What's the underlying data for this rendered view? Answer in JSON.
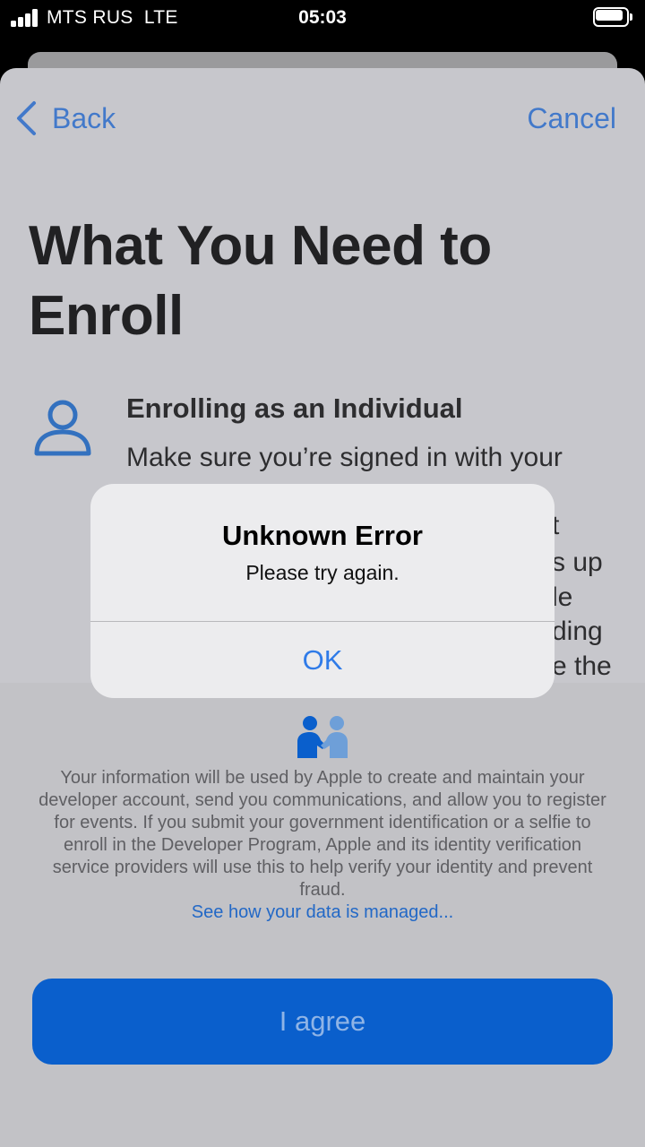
{
  "status_bar": {
    "carrier": "MTS RUS  LTE",
    "time": "05:03"
  },
  "nav": {
    "back_label": "Back",
    "cancel_label": "Cancel"
  },
  "page": {
    "title": "What You Need to Enroll",
    "section_title": "Enrolling as an Individual",
    "section_text_visible": "Make sure you’re signed in with your",
    "fragments": [
      "t",
      "s up",
      "le",
      "ding",
      "e the"
    ]
  },
  "privacy": {
    "text": "Your information will be used by Apple to create and maintain your developer account, send you communications, and allow you to register for events. If you submit your government identification or a selfie to enroll in the Developer Program, Apple and its identity verification service providers will use this to help verify your identity and prevent fraud.",
    "link": "See how your data is managed..."
  },
  "agree_button": "I agree",
  "alert": {
    "title": "Unknown Error",
    "message": "Please try again.",
    "ok": "OK"
  },
  "colors": {
    "accent": "#2f7be8",
    "button": "#0a5fcc"
  }
}
